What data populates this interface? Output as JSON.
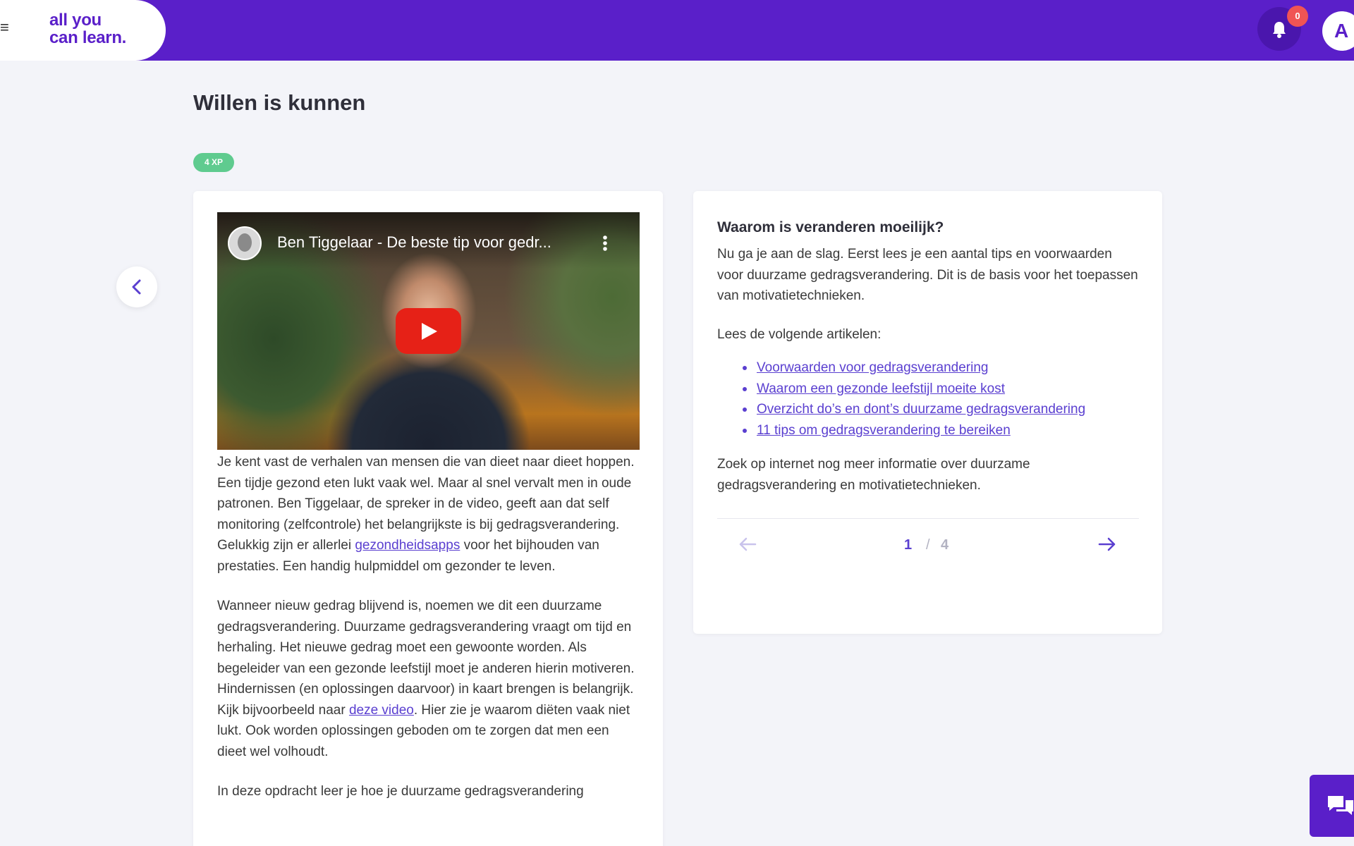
{
  "header": {
    "menu_icon": "hamburger-icon",
    "logo_line1": "all you",
    "logo_line2": "can learn.",
    "notification_count": "0",
    "avatar_initial": "A",
    "brand_color": "#5a1fc9"
  },
  "page": {
    "title": "Willen is kunnen",
    "xp_badge": "4 XP"
  },
  "video": {
    "title": "Ben Tiggelaar - De beste tip voor gedr..."
  },
  "left_card": {
    "p1_before": "Je kent vast de verhalen van mensen die van dieet naar dieet hoppen. Een tijdje gezond eten lukt vaak wel. Maar al snel vervalt men in oude patronen. Ben Tiggelaar, de spreker in de video, geeft aan dat self monitoring (zelfcontrole) het belangrijkste is bij gedragsverandering. Gelukkig zijn er allerlei ",
    "p1_link": "gezondheidsapps",
    "p1_after": " voor het bijhouden van prestaties. Een handig hulpmiddel om gezonder te leven.",
    "p2_before": "Wanneer nieuw gedrag blijvend is, noemen we dit een duurzame gedragsverandering. Duurzame gedragsverandering vraagt om tijd en herhaling. Het nieuwe gedrag moet een gewoonte worden. Als begeleider van een gezonde leefstijl moet je anderen hierin motiveren. Hindernissen (en oplossingen daarvoor) in kaart brengen is belangrijk. Kijk bijvoorbeeld naar ",
    "p2_link": "deze video",
    "p2_after": ". Hier zie je waarom diëten vaak niet lukt. Ook worden oplossingen geboden om te zorgen dat men een dieet wel volhoudt.",
    "p3": "In deze opdracht leer je hoe je duurzame gedragsverandering"
  },
  "right_card": {
    "heading": "Waarom is veranderen moeilijk?",
    "intro": "Nu ga je aan de slag. Eerst lees je een aantal tips en voorwaarden voor duurzame gedragsverandering. Dit is de basis voor het toepassen van motivatietechnieken.",
    "lees": "Lees de volgende artikelen:",
    "articles": [
      "Voorwaarden voor gedragsverandering",
      "Waarom een gezonde leefstijl moeite kost",
      "Overzicht do’s en dont’s duurzame gedragsverandering",
      "11 tips om gedragsverandering te bereiken"
    ],
    "outro": "Zoek op internet nog meer informatie over duurzame gedragsverandering en motivatietechnieken.",
    "pager": {
      "current": "1",
      "separator": "/",
      "total": "4"
    }
  }
}
